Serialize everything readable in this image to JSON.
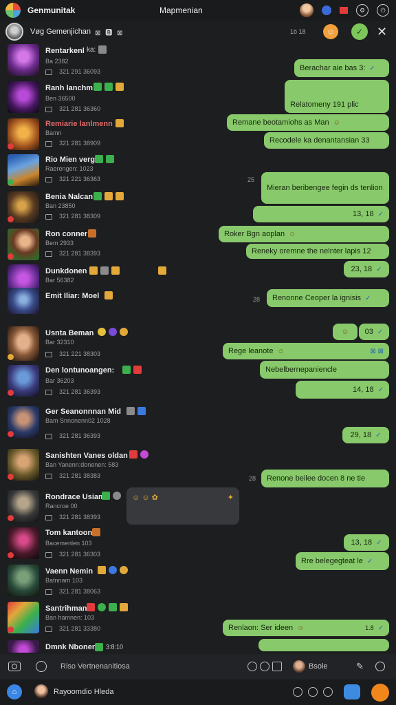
{
  "app": {
    "title": "Genmunitak",
    "center_title": "Mapmenian"
  },
  "chat_header": {
    "name": "Vøg Gemenjichan",
    "tags": "⊠ 🅱 ⊠",
    "meta": "1ö 18"
  },
  "colors": {
    "bubble": "#88c96b",
    "bg": "#1d1e20",
    "tick": "#2b6bb0",
    "accent_orange": "#f0861c",
    "accent_blue": "#3b86e6"
  },
  "contacts": [
    {
      "name": "Rentarkenl",
      "tag": "ka:",
      "sub": "Ba 2382",
      "stats": "321  291  36093"
    },
    {
      "name": "Ranh lanchm",
      "tag": "",
      "sub": "Ben 36500",
      "stats": "321  281  36360"
    },
    {
      "name": "Remiarie lanlmenn",
      "tag": "",
      "sub": "Bamn",
      "stats": "321  281  38909"
    },
    {
      "name": "Rio Mien verg:",
      "tag": "",
      "sub": "Raerengen: 1023",
      "stats": "321  221  36363"
    },
    {
      "name": "Benia Nalcan",
      "tag": "",
      "sub": "Ban 23850",
      "stats": "321  281  38309"
    },
    {
      "name": "Ron conner",
      "tag": "",
      "sub": "Bem 2933",
      "stats": "321  281  38393"
    },
    {
      "name": "Dunkdonen",
      "tag": "",
      "sub": "Bar 56382",
      "stats": ""
    },
    {
      "name": "Emit Iliar:",
      "tag": "Moel",
      "sub": "",
      "stats": ""
    },
    {
      "name": "Usnta Beman",
      "tag": "",
      "sub": "Bar 32310",
      "stats": "321  221  38303"
    },
    {
      "name": "Den lontunoangen:",
      "tag": "",
      "sub": "Bar 36203",
      "stats": "321  281  36393"
    },
    {
      "name": "Ger Seanonnnan Mid",
      "tag": "",
      "sub": "Bam Snnonenn02 1028",
      "stats": "321  281  36393"
    },
    {
      "name": "Sanishten Vanes oldan",
      "tag": "",
      "sub": "Ban Yanenn:donenen: 583",
      "stats": "321  281  38383"
    },
    {
      "name": "Rondrace Usiam",
      "tag": "",
      "sub": "Rancroe 00",
      "stats": "321  281  38393"
    },
    {
      "name": "Tom kantoon",
      "tag": "",
      "sub": "Bacemenlen 103",
      "stats": "321  281  36303"
    },
    {
      "name": "Vaenn Nemin",
      "tag": "",
      "sub": "Batnnarn 103",
      "stats": "321  281  38063"
    },
    {
      "name": "Santrihman",
      "tag": "",
      "sub": "Ban hamnen: 103",
      "stats": "321  281  33380"
    },
    {
      "name": "Dmnk Nbonen",
      "tag": "",
      "sub": "3:8:10",
      "stats": ""
    }
  ],
  "messages": [
    {
      "text": "Berachar aie bas 3:",
      "time": ""
    },
    {
      "text": "Relatomeny 191 plic",
      "time": ""
    },
    {
      "text": "Remane beotamiohs as Man",
      "time": ""
    },
    {
      "text": "Recodele ka denantansian 33",
      "time": ""
    },
    {
      "text": "Mieran beribengee fegin ds tenlion",
      "time": "25"
    },
    {
      "text": "",
      "time": "13, 18"
    },
    {
      "text": "Roker Bgn aoplan",
      "time": ""
    },
    {
      "text": "Reneky oremne the nelnter lapis 12",
      "time": ""
    },
    {
      "text": "",
      "time": "23, 18"
    },
    {
      "text": "Renonne Ceoper la ignisis",
      "time": "28"
    },
    {
      "text": "",
      "time": "03"
    },
    {
      "text": "Rege leanote",
      "time": ""
    },
    {
      "text": "Nebelbernepaniencle",
      "time": ""
    },
    {
      "text": "",
      "time": "14, 18"
    },
    {
      "text": "",
      "time": "29, 18"
    },
    {
      "text": "Renone beilee docen 8 ne tie",
      "time": "28"
    },
    {
      "text": "",
      "time": "13, 18"
    },
    {
      "text": "Rre belegegteat le",
      "time": ""
    },
    {
      "text": "Renlaon: Ser ideen",
      "time": "1.8"
    }
  ],
  "composer": {
    "placeholder": "Riso Vertnenanitiosa",
    "label": "Bsole"
  },
  "bottom": {
    "label": "Rayoomdio Hleda"
  }
}
